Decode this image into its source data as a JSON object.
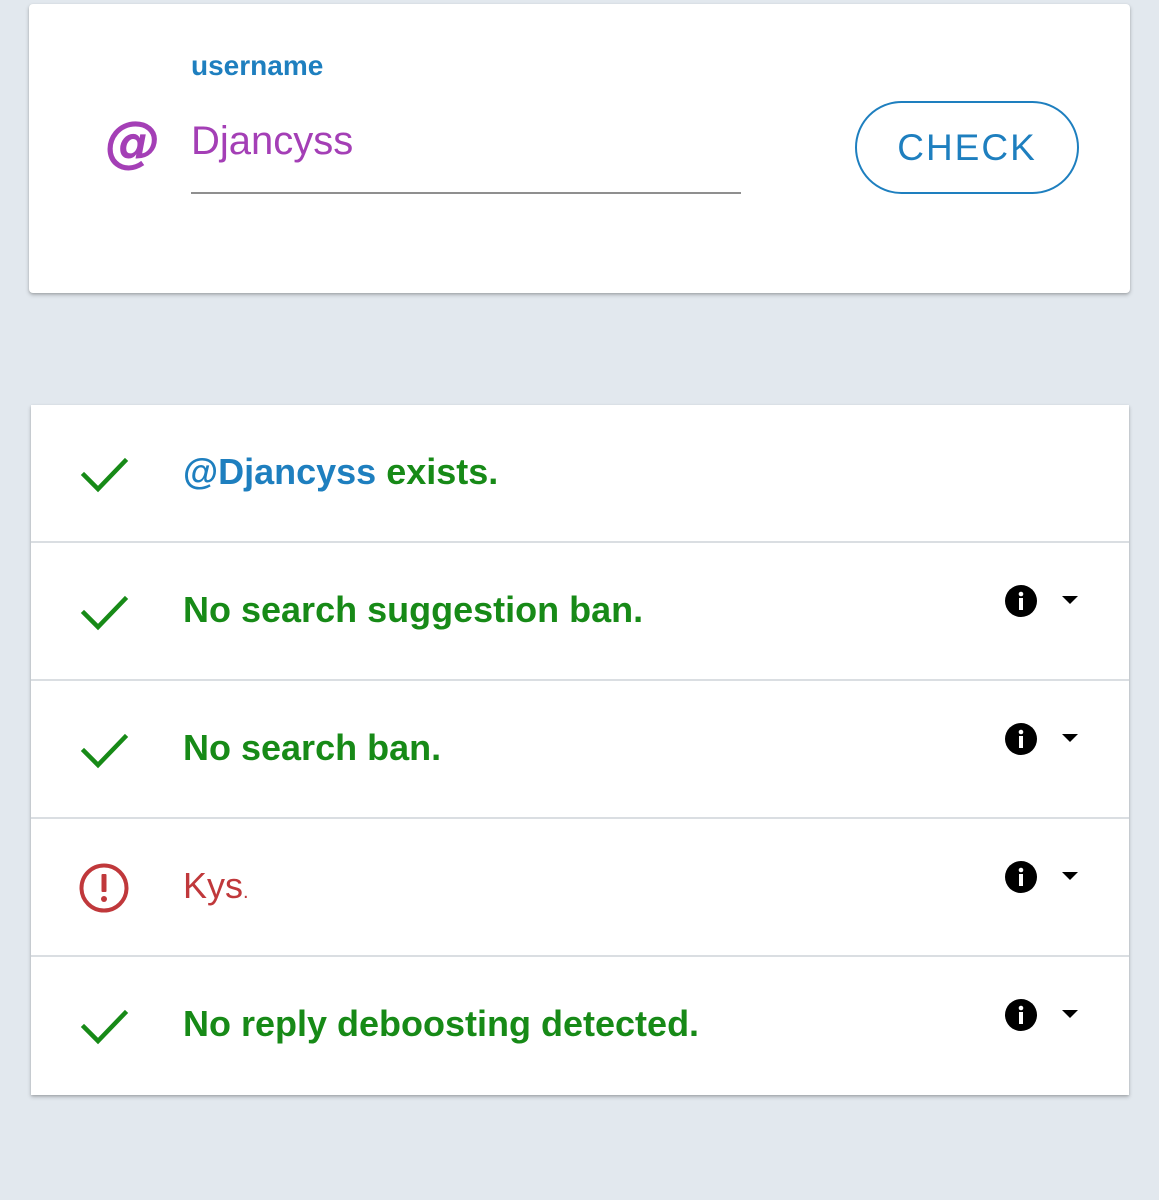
{
  "form": {
    "prefix_symbol": "@",
    "label": "username",
    "value": "Djancyss",
    "check_label": "CHECK"
  },
  "results": [
    {
      "status": "ok",
      "handle": "@Djancyss",
      "text": " exists.",
      "has_details": false
    },
    {
      "status": "ok",
      "text": "No search suggestion ban.",
      "has_details": true
    },
    {
      "status": "ok",
      "text": "No search ban.",
      "has_details": true
    },
    {
      "status": "warning",
      "text": "Kys",
      "text_suffix": ".",
      "has_details": true
    },
    {
      "status": "ok",
      "text": "No reply deboosting detected.",
      "has_details": true
    }
  ],
  "icons": {
    "ok": "checkmark-icon",
    "warning": "alert-circle-icon",
    "info": "info-icon",
    "expand": "caret-down-icon"
  },
  "colors": {
    "background": "#e2e8ee",
    "accent_blue": "#1e7fbf",
    "accent_purple": "#a43fb6",
    "ok_green": "#178a17",
    "warning_red": "#c0383b"
  }
}
